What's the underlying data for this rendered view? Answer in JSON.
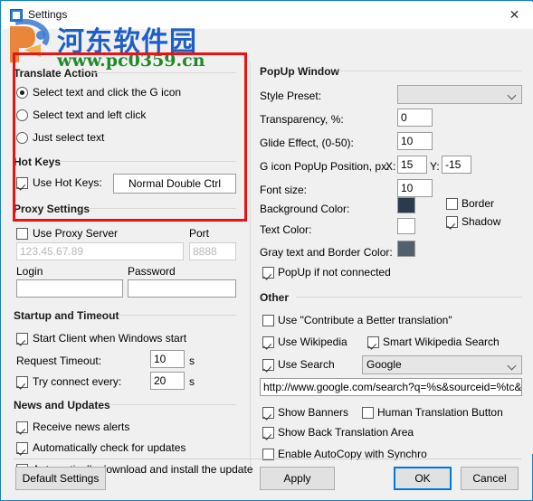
{
  "window": {
    "title": "Settings",
    "close_label": "✕",
    "app_icon": "settings-app-icon"
  },
  "watermark": {
    "site_name_cn": "河东软件园",
    "site_url": "www.pc0359.cn",
    "logo_icon": "pc0359-logo-icon",
    "color_cn": "#1f5fc4",
    "color_url": "#1f8a2a"
  },
  "annotation": {
    "highlight_color": "#ee1111"
  },
  "left": {
    "translate_action": {
      "title": "Translate Action",
      "options": [
        {
          "label": "Select text and click the G icon",
          "selected": true
        },
        {
          "label": "Select text and left click",
          "selected": false
        },
        {
          "label": "Just select text",
          "selected": false
        }
      ]
    },
    "hot_keys": {
      "title": "Hot Keys",
      "use_hot_keys": {
        "label": "Use Hot Keys:",
        "checked": true
      },
      "hotkey_button": "Normal Double Ctrl"
    },
    "proxy": {
      "title": "Proxy Settings",
      "use_proxy": {
        "label": "Use Proxy Server",
        "checked": false
      },
      "port_label": "Port",
      "server_placeholder": "123.45.67.89",
      "port_placeholder": "8888",
      "login_label": "Login",
      "login_value": "",
      "password_label": "Password",
      "password_value": ""
    },
    "startup": {
      "title": "Startup and Timeout",
      "start_client": {
        "label": "Start Client when Windows start",
        "checked": true
      },
      "request_timeout_label": "Request Timeout:",
      "request_timeout_value": "10",
      "request_timeout_unit": "s",
      "try_connect": {
        "label": "Try connect every:",
        "checked": true
      },
      "try_connect_value": "20",
      "try_connect_unit": "s"
    },
    "news": {
      "title": "News and Updates",
      "receive_news": {
        "label": "Receive news alerts",
        "checked": true
      },
      "auto_check": {
        "label": "Automatically check for updates",
        "checked": true
      },
      "auto_download": {
        "label": "Automatically download and install the update",
        "checked": true
      }
    }
  },
  "right": {
    "popup": {
      "title": "PopUp Window",
      "style_preset_label": "Style Preset:",
      "style_preset_value": "",
      "transparency_label": "Transparency, %:",
      "transparency_value": "0",
      "glide_label": "Glide Effect, (0-50):",
      "glide_value": "10",
      "position_label": "G icon PopUp Position, px:",
      "position_x_label": "X:",
      "position_x_value": "15",
      "position_y_label": "Y:",
      "position_y_value": "-15",
      "font_size_label": "Font size:",
      "font_size_value": "10",
      "background_color_label": "Background Color:",
      "background_color_value": "#2b3b4e",
      "text_color_label": "Text Color:",
      "text_color_value": "#ffffff",
      "gray_color_label": "Gray text and Border Color:",
      "gray_color_value": "#52606e",
      "border": {
        "label": "Border",
        "checked": false
      },
      "shadow": {
        "label": "Shadow",
        "checked": true
      },
      "popup_if_not_connected": {
        "label": "PopUp if not connected",
        "checked": true
      }
    },
    "other": {
      "title": "Other",
      "contribute": {
        "label": "Use \"Contribute a Better translation\"",
        "checked": false
      },
      "use_wikipedia": {
        "label": "Use Wikipedia",
        "checked": true
      },
      "smart_wikipedia": {
        "label": "Smart Wikipedia Search",
        "checked": true
      },
      "use_search": {
        "label": "Use Search",
        "checked": true
      },
      "search_engine": "Google",
      "search_url": "http://www.google.com/search?q=%s&sourceid=%tc&ie",
      "show_banners": {
        "label": "Show Banners",
        "checked": true
      },
      "human_translation": {
        "label": "Human Translation Button",
        "checked": false
      },
      "show_back_translation": {
        "label": "Show Back Translation Area",
        "checked": true
      },
      "enable_autocopy": {
        "label": "Enable AutoCopy with Synchro",
        "checked": false
      }
    }
  },
  "footer": {
    "default_settings": "Default Settings",
    "apply": "Apply",
    "ok": "OK",
    "cancel": "Cancel"
  }
}
